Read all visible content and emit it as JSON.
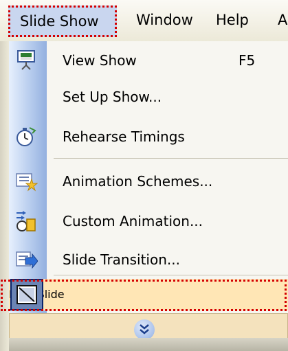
{
  "menubar": {
    "slide_show": "Slide Show",
    "window": "Window",
    "help": "Help",
    "more": "A"
  },
  "menu": {
    "items": [
      {
        "label": "View Show",
        "shortcut": "F5",
        "icon": "view-show-icon"
      },
      {
        "label": "Set Up Show...",
        "icon": ""
      },
      {
        "label": "Rehearse Timings",
        "icon": "rehearse-timings-icon"
      },
      {
        "label": "Animation Schemes...",
        "icon": "animation-schemes-icon"
      },
      {
        "label": "Custom Animation...",
        "icon": "custom-animation-icon"
      },
      {
        "label": "Slide Transition...",
        "icon": "slide-transition-icon"
      },
      {
        "label": "Hide Slide",
        "icon": "hide-slide-icon"
      }
    ],
    "expand_icon": "chevron-double-down-icon"
  },
  "colors": {
    "highlight": "#ffe6b5",
    "dotted_outline": "#d40000",
    "menu_strip": "#b8cdee"
  }
}
